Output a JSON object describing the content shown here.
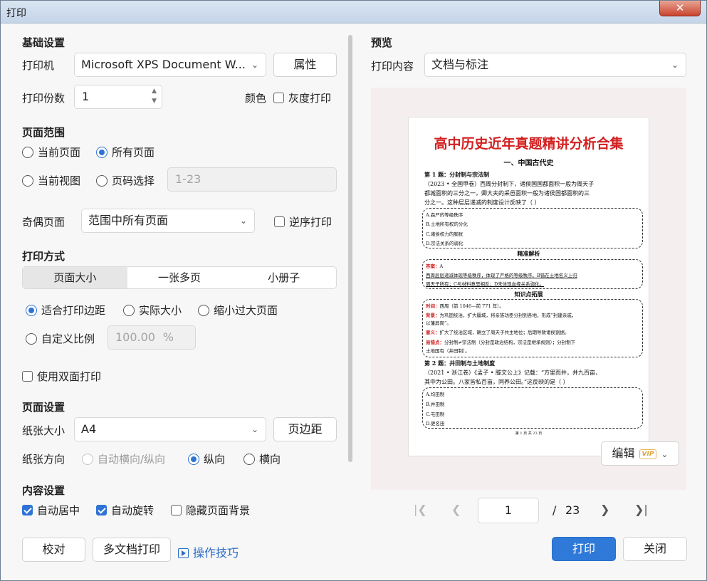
{
  "window": {
    "title": "打印",
    "close_glyph": "✕"
  },
  "basic": {
    "heading": "基础设置",
    "printer_label": "打印机",
    "printer_value": "Microsoft XPS Document W...",
    "properties_btn": "属性",
    "copies_label": "打印份数",
    "copies_value": "1",
    "color_label": "颜色",
    "grayscale_label": "灰度打印"
  },
  "range": {
    "heading": "页面范围",
    "current_page": "当前页面",
    "all_pages": "所有页面",
    "current_view": "当前视图",
    "page_select": "页码选择",
    "page_select_placeholder": "1-23",
    "odd_even_label": "奇偶页面",
    "odd_even_value": "范围中所有页面",
    "reverse_label": "逆序打印"
  },
  "mode": {
    "heading": "打印方式",
    "tabs": [
      "页面大小",
      "一张多页",
      "小册子"
    ],
    "fit_margin": "适合打印边距",
    "actual_size": "实际大小",
    "shrink_oversize": "缩小过大页面",
    "custom_scale": "自定义比例",
    "scale_value": "100.00",
    "scale_unit": "%",
    "duplex": "使用双面打印"
  },
  "page": {
    "heading": "页面设置",
    "paper_label": "纸张大小",
    "paper_value": "A4",
    "margins_btn": "页边距",
    "orient_label": "纸张方向",
    "auto_orient": "自动横向/纵向",
    "portrait": "纵向",
    "landscape": "横向"
  },
  "content": {
    "heading": "内容设置",
    "auto_center": "自动居中",
    "auto_rotate": "自动旋转",
    "hide_bg": "隐藏页面背景"
  },
  "footer": {
    "proof_btn": "校对",
    "multi_btn": "多文档打印",
    "tips_link": "操作技巧",
    "print_btn": "打印",
    "close_btn": "关闭"
  },
  "preview": {
    "heading": "预览",
    "content_label": "打印内容",
    "content_value": "文档与标注",
    "edit_btn": "编辑",
    "vip": "VIP",
    "page_current": "1",
    "page_sep": "/",
    "page_total": "23",
    "doc": {
      "title": "高中历史近年真题精讲分析合集",
      "section": "一、中国古代史",
      "q1_title": "第 1 题：分封制与宗法制",
      "q1_lines": [
        "（2023 • 全国甲卷）西周分封制下，诸侯国国都面积一般为周天子",
        "都城面积的三分之一，卿大夫的采邑面积一般为诸侯国都面积的三",
        "分之一。这种层层递减的制度设计反映了（    ）"
      ],
      "q1_opts": [
        "A.森严的等级秩序",
        "B.土地所有权的分化",
        "C.诸侯权力的膨胀",
        "D.宗法关系的弱化"
      ],
      "analysis_title": "精准解析",
      "answer_key": "答案：",
      "answer_val": "A",
      "analysis_lines": [
        "西周层层递减体现等级秩序，体现了严格的等级秩序。B错在土地名义上归",
        "周天子所有；C与材料意思相反；D未体现血缘关系弱化。"
      ],
      "ext_title": "知识点拓展",
      "ext_rows": [
        [
          "时间：",
          "西周（前 1046—前 771 年）。"
        ],
        [
          "背景：",
          "为巩固统治，扩大疆域，将亲族功臣分封到各地，形成“封建亲戚，"
        ],
        [
          "",
          "以藩屏周”。"
        ],
        [
          "意义：",
          "扩大了统治区域，确立了周天子共主地位；后期导致诸侯割据。"
        ],
        [
          "易错点：",
          "分封制≠宗法制（分封是政治结构，宗法是继承规则）；分封制下"
        ],
        [
          "",
          "土地国有（井田制）。"
        ]
      ],
      "q2_title": "第 2 题：井田制与土地制度",
      "q2_lines": [
        "（2021 • 浙江卷）《孟子 • 滕文公上》记载：“方里而井，井九百亩，",
        "其中为公田。八家皆私百亩，同养公田。”这反映的是（    ）"
      ],
      "q2_opts": [
        "A.均田制",
        "B.井田制",
        "C.屯田制",
        "D.更名田"
      ],
      "page_footer": "第 1 页 共 23 页"
    }
  }
}
